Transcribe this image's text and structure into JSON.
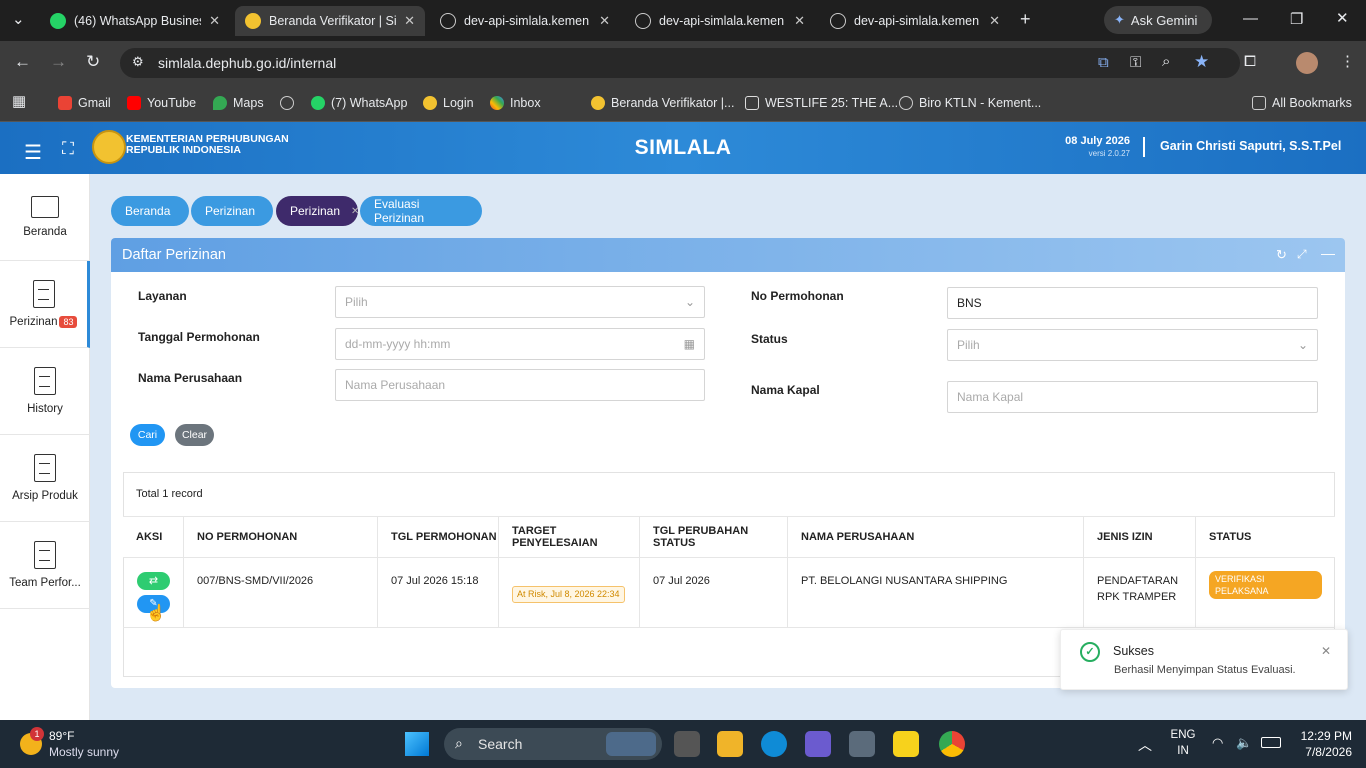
{
  "browser": {
    "tabs": [
      {
        "label": "(46) WhatsApp Busines",
        "badge": "46"
      },
      {
        "label": "Beranda Verifikator | Si"
      },
      {
        "label": "dev-api-simlala.kemen"
      },
      {
        "label": "dev-api-simlala.kemen"
      },
      {
        "label": "dev-api-simlala.kemen"
      }
    ],
    "ask_gemini": "Ask Gemini",
    "url": "simlala.dephub.go.id/internal",
    "bookmarks": [
      "Gmail",
      "YouTube",
      "Maps",
      "(7) WhatsApp",
      "Login",
      "Inbox",
      "Beranda Verifikator |...",
      "WESTLIFE 25: THE A...",
      "Biro KTLN - Kement..."
    ],
    "all_bookmarks": "All Bookmarks"
  },
  "header": {
    "org_line1": "KEMENTERIAN PERHUBUNGAN",
    "org_line2": "REPUBLIK INDONESIA",
    "app_name": "SIMLALA",
    "date": "08 July 2026",
    "version": "versi 2.0.27",
    "user": "Garin Christi Saputri, S.S.T.Pel"
  },
  "sidebar": {
    "items": [
      {
        "label": "Beranda"
      },
      {
        "label": "Perizinan",
        "badge": "83"
      },
      {
        "label": "History"
      },
      {
        "label": "Arsip Produk"
      },
      {
        "label": "Team Perfor..."
      }
    ]
  },
  "breadcrumbs": [
    "Beranda",
    "Perizinan",
    "Perizinan",
    "Evaluasi Perizinan"
  ],
  "panel": {
    "title": "Daftar Perizinan",
    "filters": {
      "layanan_label": "Layanan",
      "layanan_placeholder": "Pilih",
      "tanggal_label": "Tanggal Permohonan",
      "tanggal_placeholder": "dd-mm-yyyy hh:mm",
      "nama_perusahaan_label": "Nama Perusahaan",
      "nama_perusahaan_placeholder": "Nama Perusahaan",
      "no_permohonan_label": "No Permohonan",
      "no_permohonan_value": "BNS",
      "status_label": "Status",
      "status_placeholder": "Pilih",
      "nama_kapal_label": "Nama Kapal",
      "nama_kapal_placeholder": "Nama Kapal"
    },
    "cari_label": "Cari",
    "clear_label": "Clear",
    "total": "Total 1 record",
    "columns": [
      "AKSI",
      "NO PERMOHONAN",
      "TGL PERMOHONAN",
      "TARGET PENYELESAIAN",
      "TGL PERUBAHAN STATUS",
      "NAMA PERUSAHAAN",
      "JENIS IZIN",
      "STATUS"
    ],
    "rows": [
      {
        "no_permohonan": "007/BNS-SMD/VII/2026",
        "tgl_permohonan": "07 Jul 2026 15:18",
        "target": "At Risk, Jul 8, 2026 22:34",
        "tgl_perubahan": "07 Jul 2026",
        "nama_perusahaan": "PT. BELOLANGI NUSANTARA SHIPPING",
        "jenis_izin": "PENDAFTARAN RPK TRAMPER",
        "status": "VERIFIKASI PELAKSANA"
      }
    ]
  },
  "toast": {
    "title": "Sukses",
    "message": "Berhasil Menyimpan Status Evaluasi."
  },
  "taskbar": {
    "weather_temp": "89°F",
    "weather_desc": "Mostly sunny",
    "weather_badge": "1",
    "search": "Search",
    "lang_line1": "ENG",
    "lang_line2": "IN",
    "time": "12:29 PM",
    "date": "7/8/2026"
  },
  "colors": {
    "header_blue": "#2d8ad8",
    "crumb_blue": "#3b9ae1",
    "crumb_current": "#3e2a6b",
    "status_orange": "#f5a623",
    "success_green": "#27ae60"
  }
}
